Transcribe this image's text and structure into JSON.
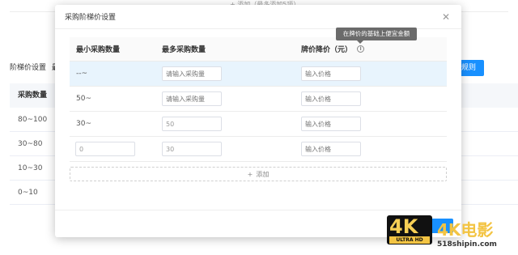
{
  "background": {
    "top_hint": "+ 添加（最多添加5项）",
    "section_label": "阶梯价设置",
    "section_sub": "最",
    "right_button": "规则",
    "table_header": "采购数量",
    "rows": [
      "80~100",
      "30~80",
      "10~30",
      "0~10"
    ]
  },
  "modal": {
    "title": "采购阶梯价设置",
    "close_icon": "close-icon",
    "columns": {
      "min_qty": "最小采购数量",
      "max_qty": "最多采购数量",
      "price_drop": "牌价降价（元）"
    },
    "tooltip": "在牌价的基础上便宜金额",
    "rows": [
      {
        "min": "--~",
        "max_placeholder": "请输入采购量",
        "max_value": "",
        "price_placeholder": "输入价格",
        "highlight": true,
        "min_is_input": false
      },
      {
        "min": "50~",
        "max_placeholder": "请输入采购量",
        "max_value": "",
        "price_placeholder": "输入价格",
        "highlight": false,
        "min_is_input": false
      },
      {
        "min": "30~",
        "max_placeholder": "",
        "max_value": "50",
        "price_placeholder": "输入价格",
        "highlight": false,
        "min_is_input": false
      },
      {
        "min": "0",
        "max_placeholder": "",
        "max_value": "30",
        "price_placeholder": "输入价格",
        "highlight": false,
        "min_is_input": true
      }
    ],
    "add_label": "添加"
  },
  "watermark": {
    "badge_text": "4K",
    "badge_sub": "ULTRA HD",
    "title": "4K电影",
    "url": "518shipin.com"
  },
  "colors": {
    "primary": "#1890ff",
    "highlight_row": "#e8f4fd",
    "tooltip_bg": "#6b6b6b"
  }
}
